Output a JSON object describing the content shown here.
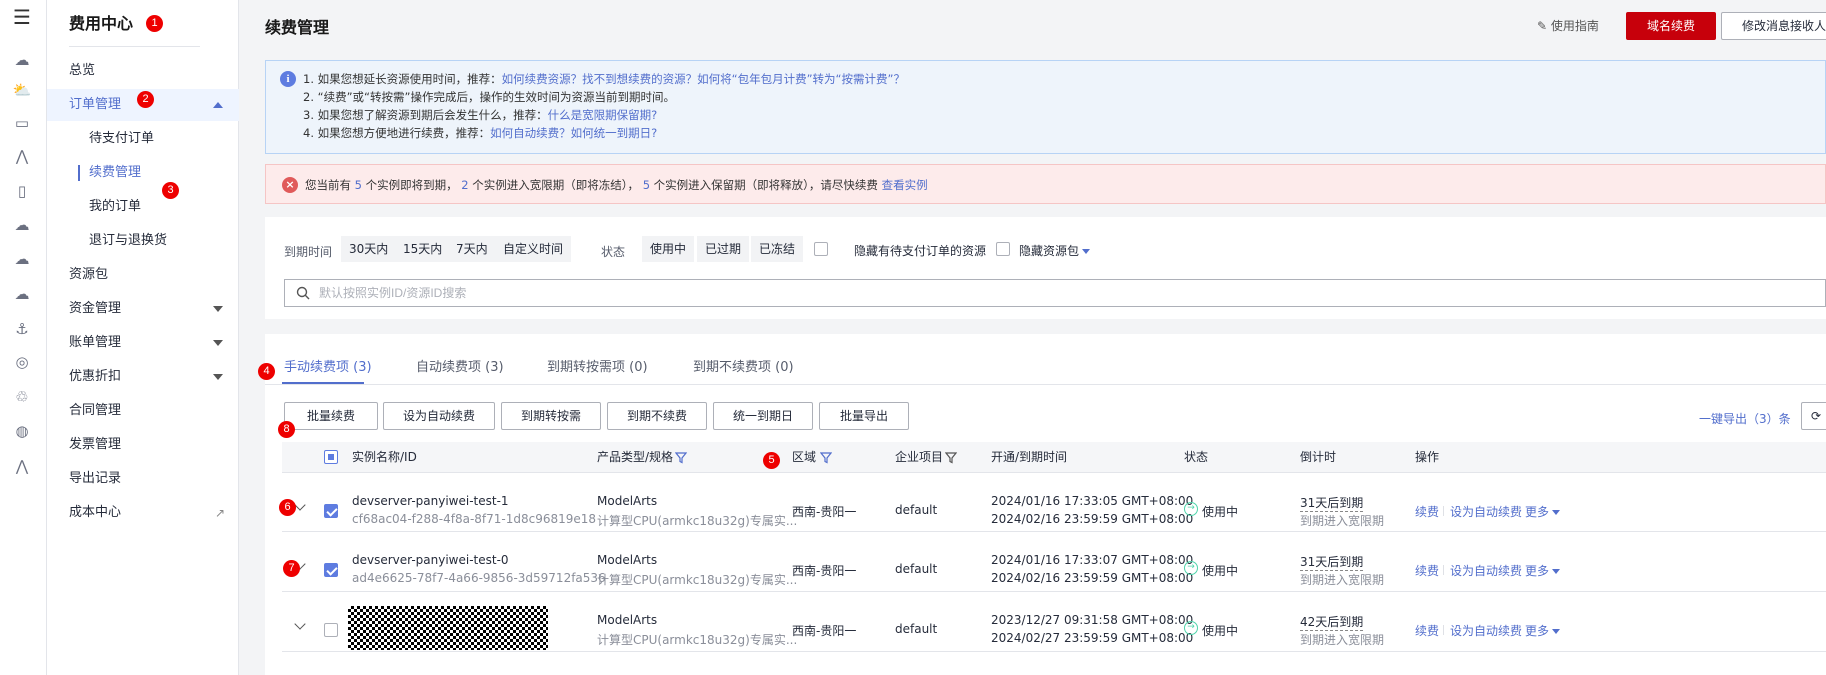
{
  "rail": {
    "icons": [
      "menu-icon",
      "cloud-icon",
      "cloud-dots-icon",
      "server-icon",
      "chart-icon",
      "file-icon",
      "cloud-outline-icon",
      "cloud-upload-icon",
      "cloud-sync-icon",
      "ship-icon",
      "ip-icon",
      "network-icon",
      "globe-icon",
      "pulse-icon"
    ]
  },
  "sidebar": {
    "title": "费用中心",
    "items": [
      {
        "label": "总览"
      },
      {
        "label": "订单管理"
      },
      {
        "label": "待支付订单"
      },
      {
        "label": "续费管理"
      },
      {
        "label": "我的订单"
      },
      {
        "label": "退订与退换货"
      },
      {
        "label": "资源包"
      },
      {
        "label": "资金管理"
      },
      {
        "label": "账单管理"
      },
      {
        "label": "优惠折扣"
      },
      {
        "label": "合同管理"
      },
      {
        "label": "发票管理"
      },
      {
        "label": "导出记录"
      },
      {
        "label": "成本中心"
      }
    ]
  },
  "badges": [
    "1",
    "2",
    "3",
    "4",
    "5",
    "6",
    "7",
    "8"
  ],
  "header": {
    "title": "续费管理",
    "guide": "使用指南",
    "domain_renew": "域名续费",
    "modify_receiver": "修改消息接收人"
  },
  "info": {
    "line1_text": "1. 如果您想延长资源使用时间，推荐：",
    "line1_link": "如何续费资源？找不到想续费的资源？如何将“包年包月计费”转为“按需计费”？",
    "line2_text": "2. “续费”或“转按需”操作完成后，操作的生效时间为资源当前到期时间。",
    "line3_text": "3. 如果您想了解资源到期后会发生什么，推荐：",
    "line3_link": "什么是宽限期保留期?",
    "line4_text": "4. 如果您想方便地进行续费，推荐：",
    "line4_link": "如何自动续费？如何统一到期日?"
  },
  "warning": {
    "p1": "您当前有",
    "n1": "5",
    "p2": "个实例即将到期，",
    "n2": "2",
    "p3": "个实例进入宽限期（即将冻结），",
    "n3": "5",
    "p4": "个实例进入保留期（即将释放），请尽快续费",
    "link": "查看实例"
  },
  "filter": {
    "expire_label": "到期时间",
    "expire_options": [
      "30天内",
      "15天内",
      "7天内",
      "自定义时间"
    ],
    "status_label": "状态",
    "status_options": [
      "使用中",
      "已过期",
      "已冻结"
    ],
    "hide_pending": "隐藏有待支付订单的资源",
    "hide_package": "隐藏资源包",
    "search_placeholder": "默认按照实例ID/资源ID搜索"
  },
  "tabs": [
    "手动续费项 (3)",
    "自动续费项 (3)",
    "到期转按需项 (0)",
    "到期不续费项 (0)"
  ],
  "toolbar": {
    "buttons": [
      "批量续费",
      "设为自动续费",
      "到期转按需",
      "到期不续费",
      "统一到期日",
      "批量导出"
    ],
    "export_all": "一键导出（3）条"
  },
  "table": {
    "headers": [
      "实例名称/ID",
      "产品类型/规格",
      "区域",
      "企业项目",
      "开通/到期时间",
      "状态",
      "倒计时",
      "操作"
    ],
    "rows": [
      {
        "name": "devserver-panyiwei-test-1",
        "id": "cf68ac04-f288-4f8a-8f71-1d8c96819e18",
        "product": "ModelArts",
        "spec": "计算型CPU(armkc18u32g)专属实...",
        "region": "西南-贵阳一",
        "project": "default",
        "start": "2024/01/16 17:33:05 GMT+08:00",
        "end": "2024/02/16 23:59:59 GMT+08:00",
        "status": "使用中",
        "countdown": "31天后到期",
        "countdown_sub": "到期进入宽限期",
        "op_renew": "续费",
        "op_auto": "设为自动续费",
        "op_more": "更多",
        "checked": true
      },
      {
        "name": "devserver-panyiwei-test-0",
        "id": "ad4e6625-78f7-4a66-9856-3d59712fa536",
        "product": "ModelArts",
        "spec": "计算型CPU(armkc18u32g)专属实...",
        "region": "西南-贵阳一",
        "project": "default",
        "start": "2024/01/16 17:33:07 GMT+08:00",
        "end": "2024/02/16 23:59:59 GMT+08:00",
        "status": "使用中",
        "countdown": "31天后到期",
        "countdown_sub": "到期进入宽限期",
        "op_renew": "续费",
        "op_auto": "设为自动续费",
        "op_more": "更多",
        "checked": true
      },
      {
        "name": "",
        "id": "",
        "product": "ModelArts",
        "spec": "计算型CPU(armkc18u32g)专属实...",
        "region": "西南-贵阳一",
        "project": "default",
        "start": "2023/12/27 09:31:58 GMT+08:00",
        "end": "2024/02/27 23:59:59 GMT+08:00",
        "status": "使用中",
        "countdown": "42天后到期",
        "countdown_sub": "到期进入宽限期",
        "op_renew": "续费",
        "op_auto": "设为自动续费",
        "op_more": "更多",
        "checked": false
      }
    ]
  },
  "colors": {
    "brand": "#c7000b",
    "link": "#526ecc",
    "status_green": "#50d4ab",
    "badge_red": "#e00000"
  }
}
